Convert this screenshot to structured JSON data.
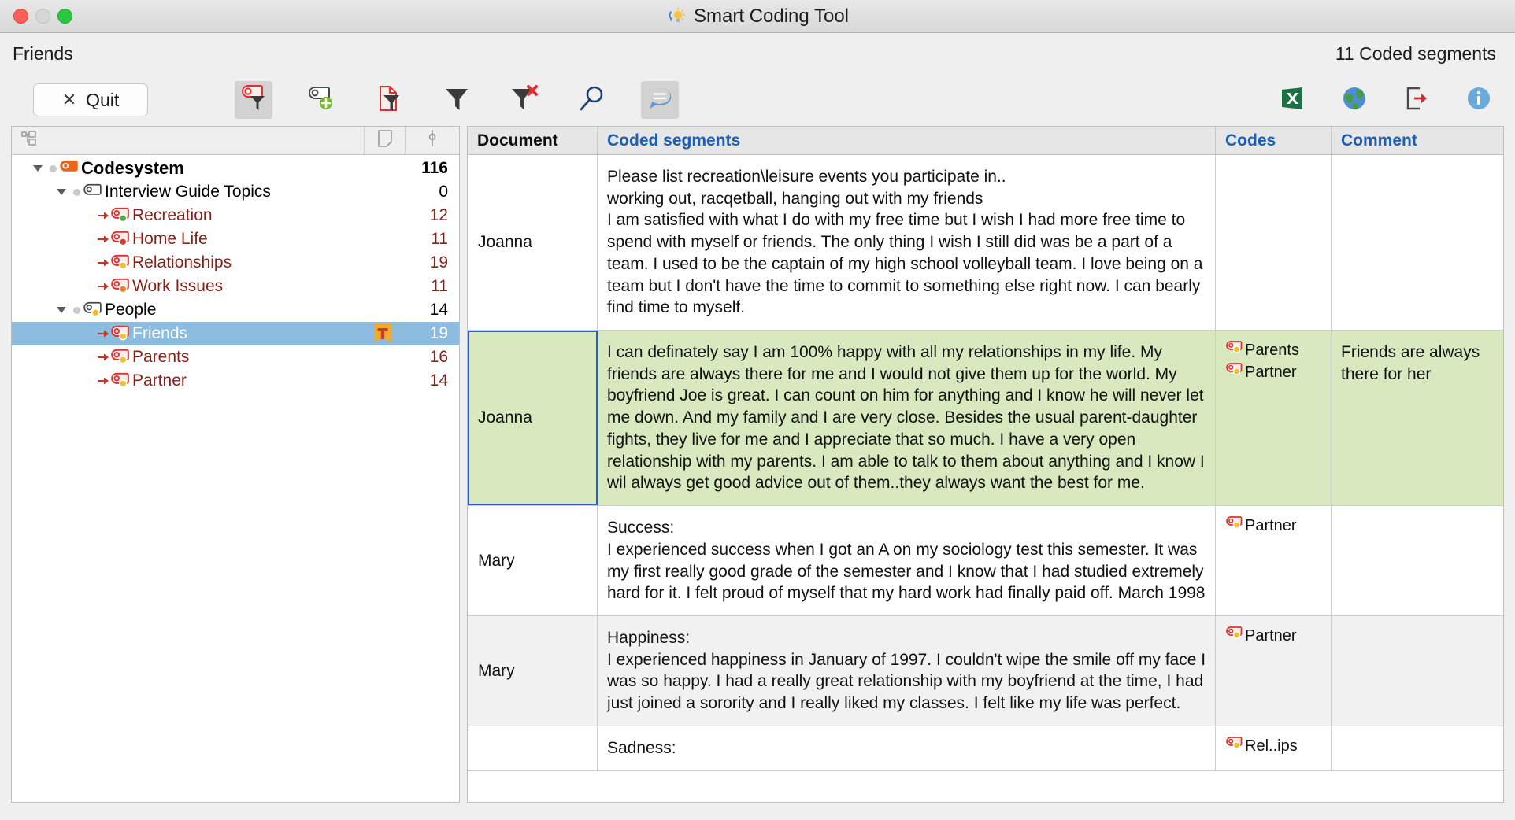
{
  "window": {
    "title": "Smart Coding Tool",
    "title_icon": "lightbulb-icon",
    "traffic_lights": [
      "close",
      "minimize",
      "maximize"
    ]
  },
  "header": {
    "context_title": "Friends",
    "segments_count_label": "11 Coded segments"
  },
  "toolbar": {
    "quit_label": "Quit",
    "quit_icon": "close-x-icon",
    "left_tools": [
      {
        "name": "filter-coded-segments-icon",
        "active": true
      },
      {
        "name": "add-code-icon",
        "active": false
      },
      {
        "name": "filter-document-icon",
        "active": false
      },
      {
        "name": "filter-icon",
        "active": false
      },
      {
        "name": "reset-filter-icon",
        "active": false
      },
      {
        "name": "search-icon",
        "active": false
      },
      {
        "name": "comment-icon",
        "active": true
      }
    ],
    "right_tools": [
      {
        "name": "export-excel-icon"
      },
      {
        "name": "export-web-icon"
      },
      {
        "name": "export-icon"
      },
      {
        "name": "info-icon"
      }
    ]
  },
  "sidebar": {
    "header_cells": [
      {
        "name": "tree-hierarchy-icon"
      },
      {
        "name": "memo-icon"
      },
      {
        "name": "segment-count-icon"
      }
    ],
    "tree": [
      {
        "label": "Codesystem",
        "count": "116",
        "level": 0,
        "kind": "root",
        "twisty": "open",
        "icon": "codesystem-icon",
        "dot": "none",
        "bullet": true,
        "badge": "",
        "selected": false
      },
      {
        "label": "Interview Guide Topics",
        "count": "0",
        "level": 1,
        "kind": "group",
        "twisty": "open",
        "icon": "code-group-icon",
        "dot": "none",
        "bullet": true,
        "badge": "",
        "selected": false
      },
      {
        "label": "Recreation",
        "count": "12",
        "level": 2,
        "kind": "leaf",
        "twisty": "none",
        "icon": "code-icon",
        "dot": "green",
        "bullet": false,
        "badge": "",
        "selected": false
      },
      {
        "label": "Home Life",
        "count": "11",
        "level": 2,
        "kind": "leaf",
        "twisty": "none",
        "icon": "code-icon",
        "dot": "red",
        "bullet": false,
        "badge": "",
        "selected": false
      },
      {
        "label": "Relationships",
        "count": "19",
        "level": 2,
        "kind": "leaf",
        "twisty": "none",
        "icon": "code-icon",
        "dot": "yellow",
        "bullet": false,
        "badge": "",
        "selected": false
      },
      {
        "label": "Work Issues",
        "count": "11",
        "level": 2,
        "kind": "leaf",
        "twisty": "none",
        "icon": "code-icon",
        "dot": "orange",
        "bullet": false,
        "badge": "",
        "selected": false
      },
      {
        "label": "People",
        "count": "14",
        "level": 1,
        "kind": "group",
        "twisty": "open",
        "icon": "code-group-icon",
        "dot": "yellow",
        "bullet": true,
        "badge": "",
        "selected": false
      },
      {
        "label": "Friends",
        "count": "19",
        "level": 2,
        "kind": "leaf",
        "twisty": "none",
        "icon": "code-icon",
        "dot": "yellow",
        "bullet": false,
        "badge": "T",
        "selected": true
      },
      {
        "label": "Parents",
        "count": "16",
        "level": 2,
        "kind": "leaf",
        "twisty": "none",
        "icon": "code-icon",
        "dot": "yellow",
        "bullet": false,
        "badge": "",
        "selected": false
      },
      {
        "label": "Partner",
        "count": "14",
        "level": 2,
        "kind": "leaf",
        "twisty": "none",
        "icon": "code-icon",
        "dot": "yellow",
        "bullet": false,
        "badge": "",
        "selected": false
      }
    ]
  },
  "table": {
    "columns": [
      {
        "key": "document",
        "label": "Document",
        "sorted": true
      },
      {
        "key": "segment",
        "label": "Coded segments",
        "sorted": false
      },
      {
        "key": "codes",
        "label": "Codes",
        "sorted": false
      },
      {
        "key": "comment",
        "label": "Comment",
        "sorted": false
      }
    ],
    "rows": [
      {
        "document": "Joanna",
        "segment": "Please list recreation\\leisure events you participate in..\nworking out, racqetball, hanging out with my friends\nI am satisfied with what I do with my free time but I wish I had more free time to spend with myself or friends.  The only thing I wish I still did was be a part of a team.  I used to be the captain of my high school volleyball team.  I love being on a team but I don't have the time to commit to something else right now.  I can bearly find time to myself.",
        "codes": [],
        "comment": "",
        "selected": false,
        "stripe": "odd"
      },
      {
        "document": "Joanna",
        "segment": "I can definately say I am 100% happy with all my relationships in my life.  My friends are always there for me and I would not give them up for the world.  My boyfriend Joe is great.  I can count on him for anything and I know he will never let me down.  And my family and I are very close.  Besides the usual parent-daughter fights, they live for me and I appreciate that so much.  I have a very open relationship with my parents.  I am able to talk to them about anything and I know I wil always get good advice out of them..they always want the best for me.",
        "codes": [
          {
            "label": "Parents",
            "dot": "yellow"
          },
          {
            "label": "Partner",
            "dot": "yellow"
          }
        ],
        "comment": "Friends are always there for her",
        "selected": true,
        "stripe": "sel"
      },
      {
        "document": "Mary",
        "segment": "Success:\nI experienced success when I got an A on my sociology test this semester. It was my first really good grade of the semester and I know that I had studied extremely hard for it. I felt proud of myself that my hard work had finally paid off. March 1998",
        "codes": [
          {
            "label": "Partner",
            "dot": "yellow"
          }
        ],
        "comment": "",
        "selected": false,
        "stripe": "odd"
      },
      {
        "document": "Mary",
        "segment": "Happiness:\nI experienced happiness in January of 1997. I couldn't wipe the smile off my face I was so happy. I had a really great relationship with my boyfriend at the time, I had just joined a sorority and I really liked my classes. I felt like my life was perfect.",
        "codes": [
          {
            "label": "Partner",
            "dot": "yellow"
          }
        ],
        "comment": "",
        "selected": false,
        "stripe": "even"
      },
      {
        "document": "",
        "segment": "Sadness:",
        "codes": [
          {
            "label": "Rel..ips",
            "dot": "yellow"
          }
        ],
        "comment": "",
        "selected": false,
        "stripe": "odd"
      }
    ]
  },
  "colors": {
    "selection_blue": "#8cbcdf",
    "selected_row_green": "#d8e9bf",
    "code_red": "#8a1f18",
    "link_blue": "#1a5fb4",
    "excel_green": "#1d7044",
    "focus_border": "#2a5bd7"
  }
}
